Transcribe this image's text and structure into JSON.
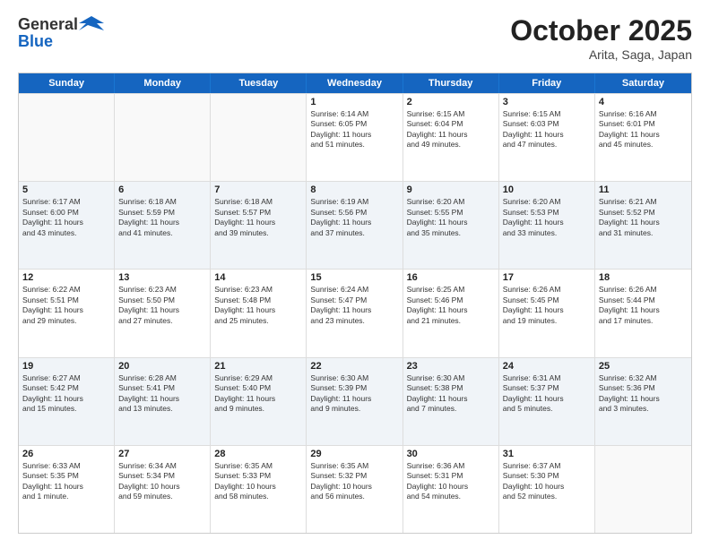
{
  "header": {
    "logo_general": "General",
    "logo_blue": "Blue",
    "month": "October 2025",
    "location": "Arita, Saga, Japan"
  },
  "weekdays": [
    "Sunday",
    "Monday",
    "Tuesday",
    "Wednesday",
    "Thursday",
    "Friday",
    "Saturday"
  ],
  "rows": [
    {
      "alt": false,
      "cells": [
        {
          "day": "",
          "lines": []
        },
        {
          "day": "",
          "lines": []
        },
        {
          "day": "",
          "lines": []
        },
        {
          "day": "1",
          "lines": [
            "Sunrise: 6:14 AM",
            "Sunset: 6:05 PM",
            "Daylight: 11 hours",
            "and 51 minutes."
          ]
        },
        {
          "day": "2",
          "lines": [
            "Sunrise: 6:15 AM",
            "Sunset: 6:04 PM",
            "Daylight: 11 hours",
            "and 49 minutes."
          ]
        },
        {
          "day": "3",
          "lines": [
            "Sunrise: 6:15 AM",
            "Sunset: 6:03 PM",
            "Daylight: 11 hours",
            "and 47 minutes."
          ]
        },
        {
          "day": "4",
          "lines": [
            "Sunrise: 6:16 AM",
            "Sunset: 6:01 PM",
            "Daylight: 11 hours",
            "and 45 minutes."
          ]
        }
      ]
    },
    {
      "alt": true,
      "cells": [
        {
          "day": "5",
          "lines": [
            "Sunrise: 6:17 AM",
            "Sunset: 6:00 PM",
            "Daylight: 11 hours",
            "and 43 minutes."
          ]
        },
        {
          "day": "6",
          "lines": [
            "Sunrise: 6:18 AM",
            "Sunset: 5:59 PM",
            "Daylight: 11 hours",
            "and 41 minutes."
          ]
        },
        {
          "day": "7",
          "lines": [
            "Sunrise: 6:18 AM",
            "Sunset: 5:57 PM",
            "Daylight: 11 hours",
            "and 39 minutes."
          ]
        },
        {
          "day": "8",
          "lines": [
            "Sunrise: 6:19 AM",
            "Sunset: 5:56 PM",
            "Daylight: 11 hours",
            "and 37 minutes."
          ]
        },
        {
          "day": "9",
          "lines": [
            "Sunrise: 6:20 AM",
            "Sunset: 5:55 PM",
            "Daylight: 11 hours",
            "and 35 minutes."
          ]
        },
        {
          "day": "10",
          "lines": [
            "Sunrise: 6:20 AM",
            "Sunset: 5:53 PM",
            "Daylight: 11 hours",
            "and 33 minutes."
          ]
        },
        {
          "day": "11",
          "lines": [
            "Sunrise: 6:21 AM",
            "Sunset: 5:52 PM",
            "Daylight: 11 hours",
            "and 31 minutes."
          ]
        }
      ]
    },
    {
      "alt": false,
      "cells": [
        {
          "day": "12",
          "lines": [
            "Sunrise: 6:22 AM",
            "Sunset: 5:51 PM",
            "Daylight: 11 hours",
            "and 29 minutes."
          ]
        },
        {
          "day": "13",
          "lines": [
            "Sunrise: 6:23 AM",
            "Sunset: 5:50 PM",
            "Daylight: 11 hours",
            "and 27 minutes."
          ]
        },
        {
          "day": "14",
          "lines": [
            "Sunrise: 6:23 AM",
            "Sunset: 5:48 PM",
            "Daylight: 11 hours",
            "and 25 minutes."
          ]
        },
        {
          "day": "15",
          "lines": [
            "Sunrise: 6:24 AM",
            "Sunset: 5:47 PM",
            "Daylight: 11 hours",
            "and 23 minutes."
          ]
        },
        {
          "day": "16",
          "lines": [
            "Sunrise: 6:25 AM",
            "Sunset: 5:46 PM",
            "Daylight: 11 hours",
            "and 21 minutes."
          ]
        },
        {
          "day": "17",
          "lines": [
            "Sunrise: 6:26 AM",
            "Sunset: 5:45 PM",
            "Daylight: 11 hours",
            "and 19 minutes."
          ]
        },
        {
          "day": "18",
          "lines": [
            "Sunrise: 6:26 AM",
            "Sunset: 5:44 PM",
            "Daylight: 11 hours",
            "and 17 minutes."
          ]
        }
      ]
    },
    {
      "alt": true,
      "cells": [
        {
          "day": "19",
          "lines": [
            "Sunrise: 6:27 AM",
            "Sunset: 5:42 PM",
            "Daylight: 11 hours",
            "and 15 minutes."
          ]
        },
        {
          "day": "20",
          "lines": [
            "Sunrise: 6:28 AM",
            "Sunset: 5:41 PM",
            "Daylight: 11 hours",
            "and 13 minutes."
          ]
        },
        {
          "day": "21",
          "lines": [
            "Sunrise: 6:29 AM",
            "Sunset: 5:40 PM",
            "Daylight: 11 hours",
            "and 9 minutes."
          ]
        },
        {
          "day": "22",
          "lines": [
            "Sunrise: 6:30 AM",
            "Sunset: 5:39 PM",
            "Daylight: 11 hours",
            "and 9 minutes."
          ]
        },
        {
          "day": "23",
          "lines": [
            "Sunrise: 6:30 AM",
            "Sunset: 5:38 PM",
            "Daylight: 11 hours",
            "and 7 minutes."
          ]
        },
        {
          "day": "24",
          "lines": [
            "Sunrise: 6:31 AM",
            "Sunset: 5:37 PM",
            "Daylight: 11 hours",
            "and 5 minutes."
          ]
        },
        {
          "day": "25",
          "lines": [
            "Sunrise: 6:32 AM",
            "Sunset: 5:36 PM",
            "Daylight: 11 hours",
            "and 3 minutes."
          ]
        }
      ]
    },
    {
      "alt": false,
      "cells": [
        {
          "day": "26",
          "lines": [
            "Sunrise: 6:33 AM",
            "Sunset: 5:35 PM",
            "Daylight: 11 hours",
            "and 1 minute."
          ]
        },
        {
          "day": "27",
          "lines": [
            "Sunrise: 6:34 AM",
            "Sunset: 5:34 PM",
            "Daylight: 10 hours",
            "and 59 minutes."
          ]
        },
        {
          "day": "28",
          "lines": [
            "Sunrise: 6:35 AM",
            "Sunset: 5:33 PM",
            "Daylight: 10 hours",
            "and 58 minutes."
          ]
        },
        {
          "day": "29",
          "lines": [
            "Sunrise: 6:35 AM",
            "Sunset: 5:32 PM",
            "Daylight: 10 hours",
            "and 56 minutes."
          ]
        },
        {
          "day": "30",
          "lines": [
            "Sunrise: 6:36 AM",
            "Sunset: 5:31 PM",
            "Daylight: 10 hours",
            "and 54 minutes."
          ]
        },
        {
          "day": "31",
          "lines": [
            "Sunrise: 6:37 AM",
            "Sunset: 5:30 PM",
            "Daylight: 10 hours",
            "and 52 minutes."
          ]
        },
        {
          "day": "",
          "lines": []
        }
      ]
    }
  ]
}
